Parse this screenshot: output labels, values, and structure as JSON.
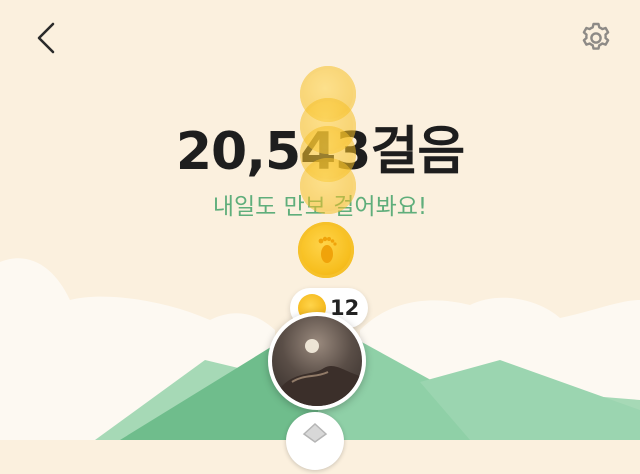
{
  "header": {
    "back_icon": "chevron-left-icon",
    "settings_icon": "gear-icon"
  },
  "main": {
    "step_count": "20,543걸음",
    "message": "내일도 만보 걸어봐요!"
  },
  "reward": {
    "coin_icon": "footprint-coin-icon",
    "count": "12"
  },
  "colors": {
    "background": "#fbf0de",
    "mountain_green": "#7cc597",
    "message_green": "#5fae7b",
    "coin_gold": "#f7bf1f"
  }
}
